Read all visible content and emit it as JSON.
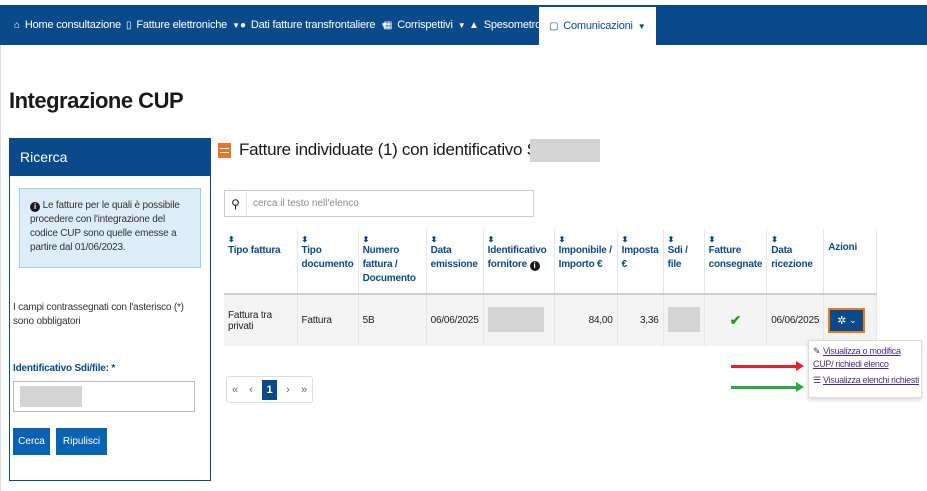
{
  "nav": {
    "items": [
      {
        "label": "Home consultazione",
        "icon": "home-icon"
      },
      {
        "label": "Fatture elettroniche",
        "icon": "document-icon",
        "dropdown": true
      },
      {
        "label": "Dati fatture transfrontaliere",
        "icon": "globe-icon",
        "dropdown": true
      },
      {
        "label": "Corrispettivi",
        "icon": "calculator-icon",
        "dropdown": true
      },
      {
        "label": "Spesometro",
        "icon": "building-icon"
      },
      {
        "label": "Comunicazioni",
        "icon": "file-icon",
        "dropdown": true,
        "active": true
      }
    ]
  },
  "page": {
    "title": "Integrazione CUP"
  },
  "sidebar": {
    "title": "Ricerca",
    "info": "Le fatture per le quali è possibile procedere con l'integrazione del codice CUP sono quelle emesse a partire dal 01/06/2023.",
    "required_note": "I campi contrassegnati con l'asterisco (*) sono obbligatori",
    "field_label": "Identificativo Sdi/file: *",
    "search_button": "Cerca",
    "reset_button": "Ripulisci"
  },
  "results": {
    "title": "Fatture individuate (1) con identificativo Sdi/file",
    "search_placeholder": "cerca il testo nell'elenco",
    "columns": [
      "Tipo fattura",
      "Tipo documento",
      "Numero fattura / Documento",
      "Data emissione",
      "Identificativo fornitore",
      "Imponibile / Importo €",
      "Imposta €",
      "Sdi / file",
      "Fatture consegnate",
      "Data ricezione",
      "Azioni"
    ],
    "rows": [
      {
        "tipo_fattura": "Fattura tra privati",
        "tipo_documento": "Fattura",
        "numero": "5B",
        "data_emissione": "06/06/2025",
        "imponibile": "84,00",
        "imposta": "3,36",
        "data_ricezione": "06/06/2025"
      }
    ]
  },
  "actions_menu": {
    "items": [
      {
        "label": "Visualizza o modifica CUP/ richiedi elenco",
        "icon": "pencil-icon"
      },
      {
        "label": "Visualizza elenchi richiesti",
        "icon": "list-icon"
      }
    ]
  },
  "pagination": {
    "prev_all": "«",
    "prev": "‹",
    "current": "1",
    "next": "›",
    "next_all": "»"
  },
  "colors": {
    "navbar": "#0b4a8a",
    "accent_orange": "#e8752a",
    "arrow_red": "#e8232a",
    "arrow_green": "#2aa84a",
    "check_green": "#2e9a2e"
  }
}
